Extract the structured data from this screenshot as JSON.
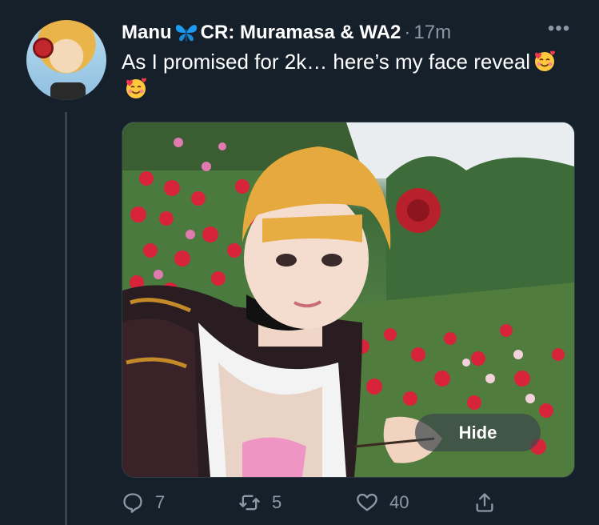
{
  "tweet": {
    "author_name": "Manu",
    "author_name_suffix": "CR: Muramasa & WA2",
    "separator": "·",
    "timestamp": "17m",
    "more_label": "•••",
    "text": "As I promised for 2k… here’s my face reveal",
    "media": {
      "hide_label": "Hide"
    }
  },
  "actions": {
    "reply_count": "7",
    "retweet_count": "5",
    "like_count": "40"
  },
  "colors": {
    "background": "#15202b",
    "secondary_text": "#8b98a5",
    "thread_line": "#38444d",
    "butterfly": "#1d9bf0"
  },
  "icons": {
    "author_badge": "butterfly-icon",
    "emoji": "smiling-face-with-hearts-emoji",
    "reply": "reply-icon",
    "retweet": "retweet-icon",
    "like": "heart-icon",
    "share": "share-icon"
  }
}
